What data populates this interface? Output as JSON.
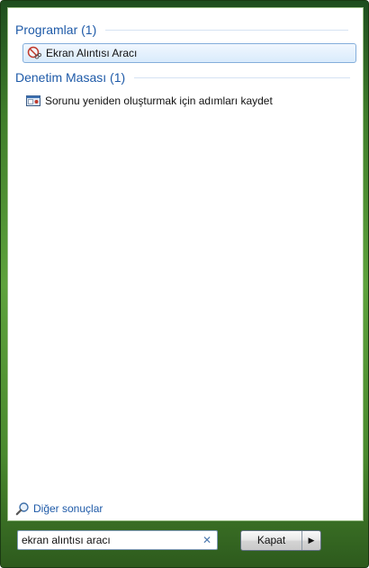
{
  "groups": [
    {
      "header": "Programlar (1)",
      "items": [
        {
          "label": "Ekran Alıntısı Aracı",
          "icon": "snipping-tool-icon",
          "selected": true
        }
      ]
    },
    {
      "header": "Denetim Masası (1)",
      "items": [
        {
          "label": "Sorunu yeniden oluşturmak için adımları kaydet",
          "icon": "steps-recorder-icon",
          "selected": false
        }
      ]
    }
  ],
  "more_results": {
    "label": "Diğer sonuçlar",
    "icon": "search-icon"
  },
  "search": {
    "value": "ekran alıntısı aracı",
    "clear_icon": "close-icon"
  },
  "shutdown": {
    "label": "Kapat",
    "arrow_icon": "triangle-right-icon"
  },
  "colors": {
    "accent": "#1e5aa8",
    "frame": "#4a8a2e",
    "selection": "#d9ebfc"
  }
}
